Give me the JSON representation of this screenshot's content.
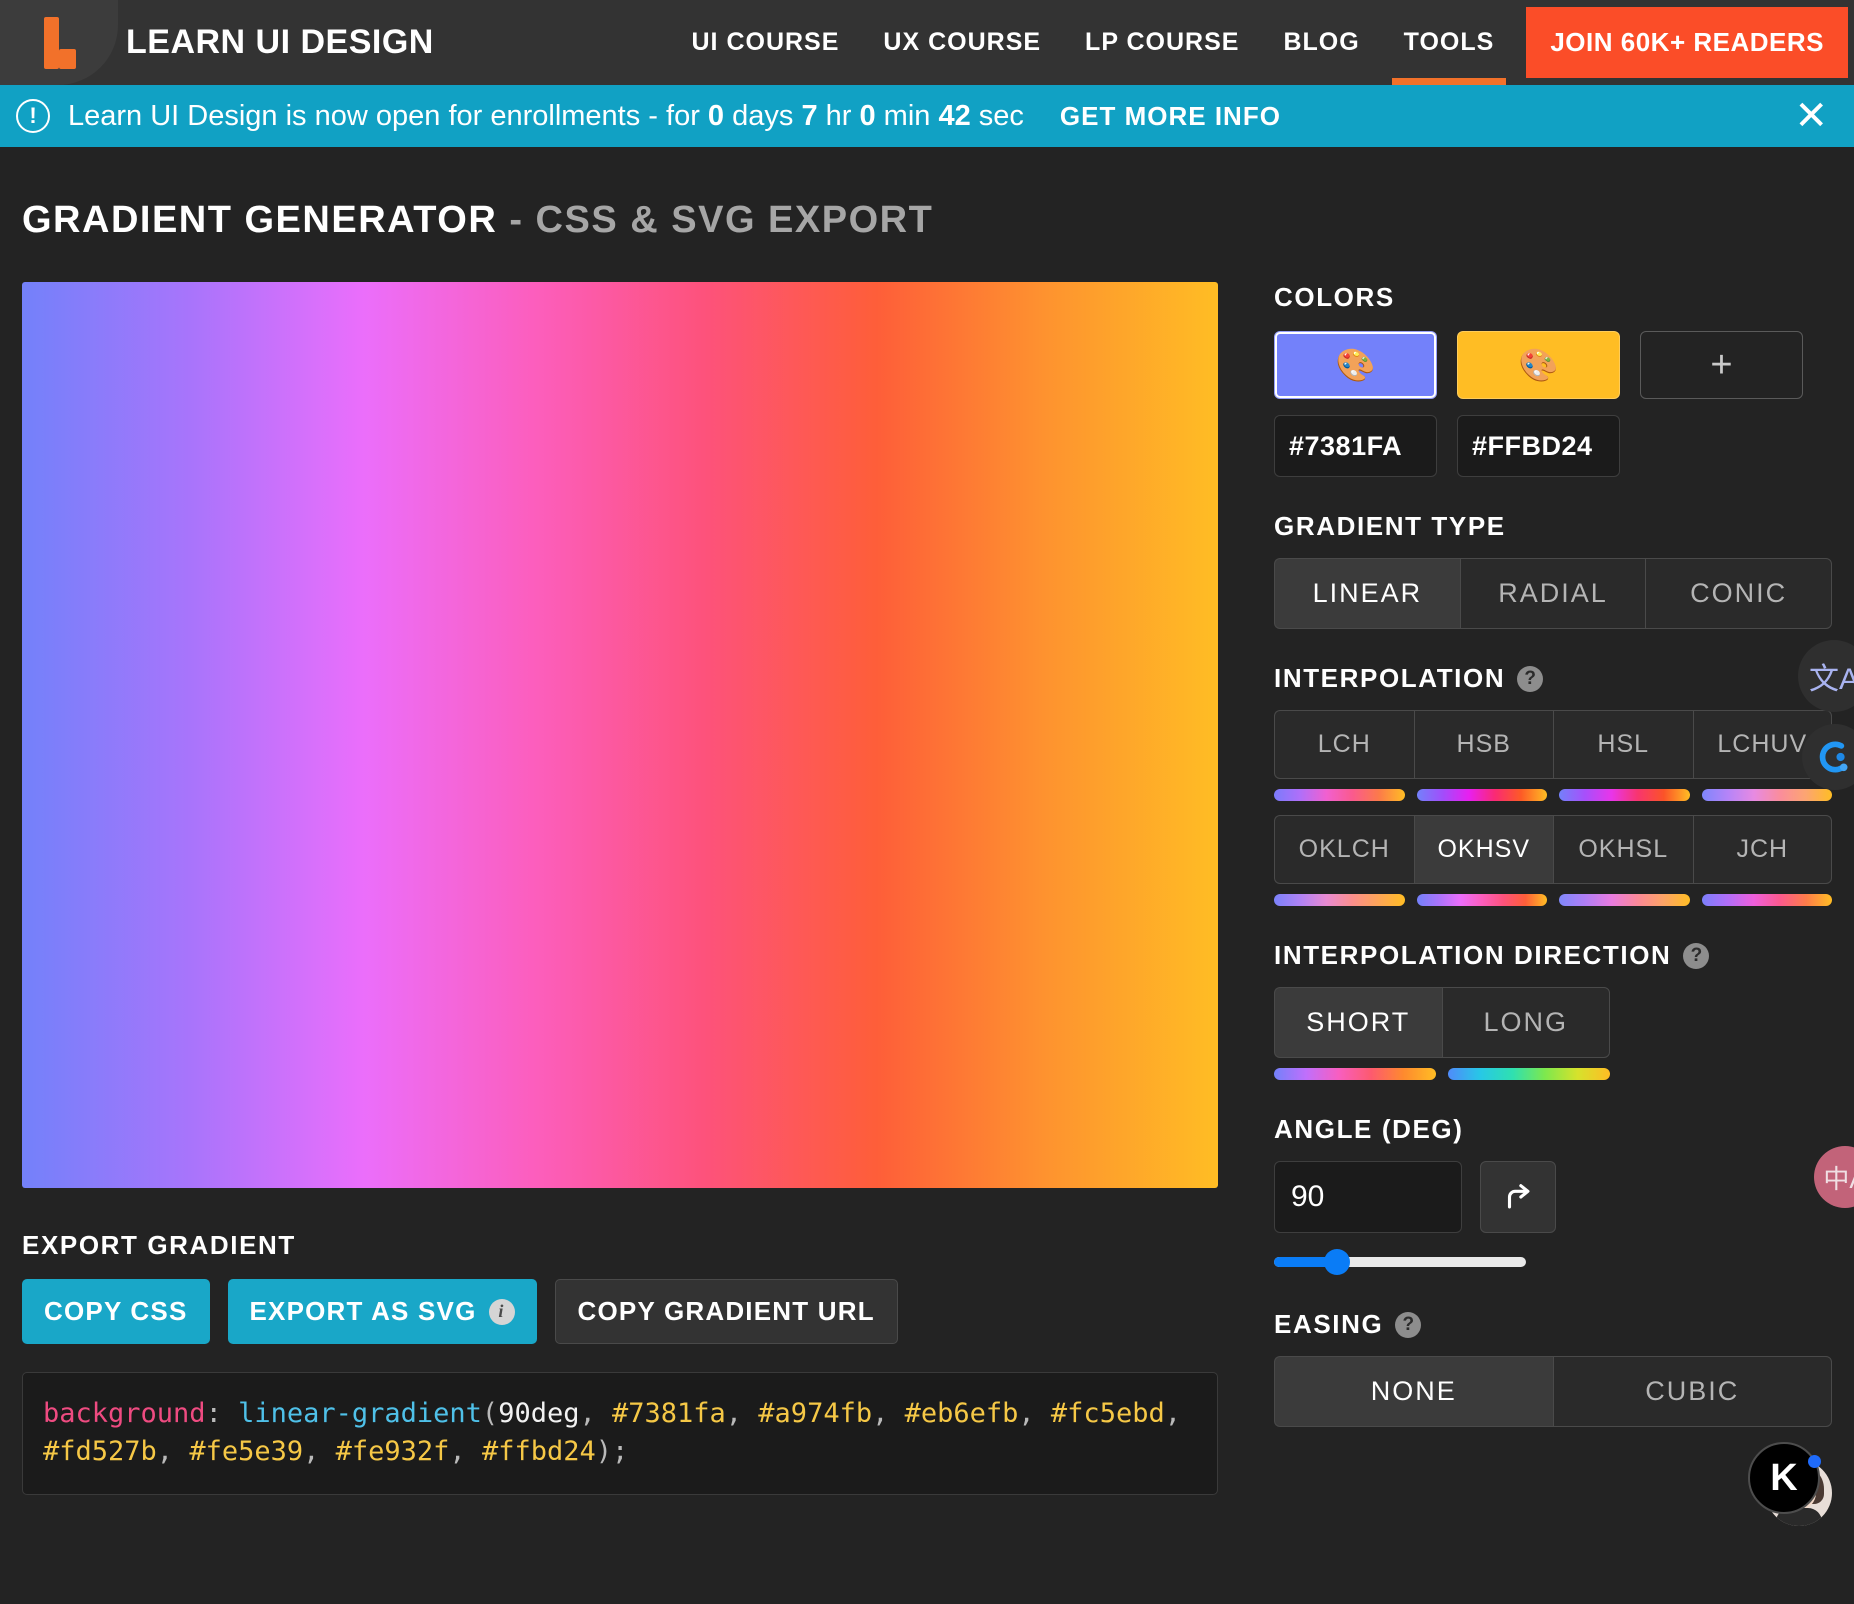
{
  "header": {
    "logo_icon": "learn-ui-design-logo",
    "brand": "LEARN UI DESIGN",
    "nav": [
      {
        "label": "UI COURSE",
        "active": false
      },
      {
        "label": "UX COURSE",
        "active": false
      },
      {
        "label": "LP COURSE",
        "active": false
      },
      {
        "label": "BLOG",
        "active": false
      },
      {
        "label": "TOOLS",
        "active": true
      }
    ],
    "cta": "JOIN 60K+ READERS",
    "accent_color": "#f2712a",
    "cta_color": "#fb4d28"
  },
  "announcement": {
    "icon": "alert-circle-icon",
    "text_prefix": "Learn UI Design is now open for enrollments - for ",
    "days_value": "0",
    "days_unit": " days ",
    "hours_value": "7",
    "hours_unit": " hr ",
    "minutes_value": "0",
    "minutes_unit": " min ",
    "seconds_value": "42",
    "seconds_unit": " sec",
    "cta": "GET MORE INFO",
    "close_icon": "close-icon",
    "background": "#11a1c4"
  },
  "page": {
    "title_primary": "GRADIENT GENERATOR",
    "title_secondary": "- CSS & SVG EXPORT"
  },
  "preview": {
    "css_gradient": "linear-gradient(90deg, #7381fa, #a974fb, #eb6efb, #fc5ebd, #fd527b, #fe5e39, #fe932f, #ffbd24)"
  },
  "export": {
    "heading": "EXPORT GRADIENT",
    "copy_css_label": "COPY CSS",
    "export_svg_label": "EXPORT AS SVG",
    "export_svg_info_icon": "info-icon",
    "copy_url_label": "COPY GRADIENT URL"
  },
  "code": {
    "property": "background",
    "colon": ": ",
    "function": "linear-gradient",
    "open_paren": "(",
    "angle": "90deg",
    "sep": ", ",
    "stops": [
      "#7381fa",
      "#a974fb",
      "#eb6efb",
      "#fc5ebd",
      "#fd527b",
      "#fe5e39",
      "#fe932f",
      "#ffbd24"
    ],
    "close": ");"
  },
  "colors_panel": {
    "heading": "COLORS",
    "swatch_icon": "palette-icon",
    "swatches": [
      {
        "hex": "#7381FA",
        "fill": "#7381fa",
        "selected": true
      },
      {
        "hex": "#FFBD24",
        "fill": "#ffbd24",
        "selected": false
      }
    ],
    "add_label": "+",
    "add_icon": "plus-icon"
  },
  "gradient_type": {
    "heading": "GRADIENT TYPE",
    "options": [
      {
        "label": "LINEAR",
        "active": true
      },
      {
        "label": "RADIAL",
        "active": false
      },
      {
        "label": "CONIC",
        "active": false
      }
    ]
  },
  "interpolation": {
    "heading": "INTERPOLATION",
    "help_icon": "help-icon",
    "options": [
      {
        "label": "LCH",
        "active": false,
        "preview": "linear-gradient(90deg,#7b7bfb,#b06ff9,#f160d0,#fa5a8d,#fc7a4a,#ffbd24)"
      },
      {
        "label": "HSB",
        "active": false,
        "preview": "linear-gradient(90deg,#7381fa,#a24dfb,#e81ff0,#fa2a73,#fd5a26,#ffbd24)"
      },
      {
        "label": "HSL",
        "active": false,
        "preview": "linear-gradient(90deg,#7381fa,#a74ffb,#e835ea,#f8356f,#fb5328,#ffbd24)"
      },
      {
        "label": "LCHUV",
        "active": false,
        "preview": "linear-gradient(90deg,#7f86fb,#b584f8,#e78ae2,#fa8d9c,#fca571,#ffbd24)"
      },
      {
        "label": "OKLCH",
        "active": false,
        "preview": "linear-gradient(90deg,#7b82fa,#b083f5,#e88ad2,#fb8f8c,#fda557,#ffbd24)"
      },
      {
        "label": "OKHSV",
        "active": true,
        "preview": "linear-gradient(90deg,#7381fa,#a974fb,#eb6efb,#fc5ebd,#fd527b,#fe5e39,#ffbd24)"
      },
      {
        "label": "OKHSL",
        "active": false,
        "preview": "linear-gradient(90deg,#7f88fa,#b07ef6,#e97ce0,#fb8999,#fda465,#ffbd24)"
      },
      {
        "label": "JCH",
        "active": false,
        "preview": "linear-gradient(90deg,#7b7ffb,#b26ef9,#ef5fdb,#fc5a8e,#fd7c4a,#ffbd24)"
      }
    ]
  },
  "interpolation_direction": {
    "heading": "INTERPOLATION DIRECTION",
    "help_icon": "help-icon",
    "options": [
      {
        "label": "SHORT",
        "active": true,
        "preview": "linear-gradient(90deg,#7381fa,#c06ffb,#f85ec0,#fd5a6e,#fe8a2e,#ffbd24)"
      },
      {
        "label": "LONG",
        "active": false,
        "preview": "linear-gradient(90deg,#4f8bfa,#27c8e6,#2fe0b0,#7ee84d,#d6e22c,#ffbd24)"
      }
    ]
  },
  "angle": {
    "heading": "ANGLE (DEG)",
    "value": "90",
    "rotate_icon": "rotate-arrow-icon",
    "slider_percent": 25
  },
  "easing": {
    "heading": "EASING",
    "help_icon": "help-icon",
    "options": [
      {
        "label": "NONE",
        "active": true
      },
      {
        "label": "CUBIC",
        "active": false
      }
    ]
  },
  "floating": {
    "translate_icon_top": "translate-icon",
    "assistant_icon": "assistant-widget-icon",
    "translate_icon_pink": "translate-icon",
    "chat_logo": "K",
    "chat_avatar": "avatar-icon"
  }
}
